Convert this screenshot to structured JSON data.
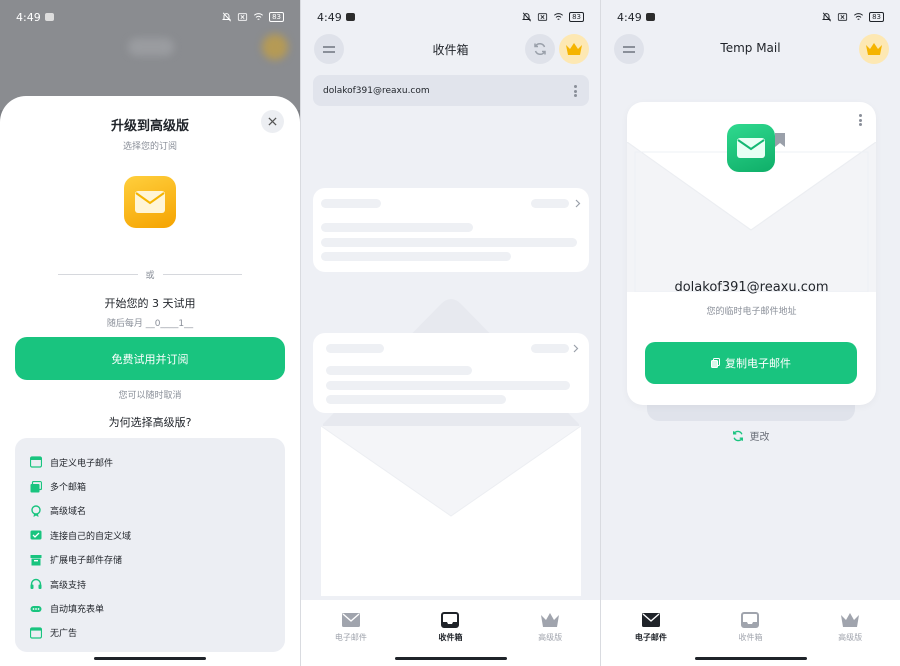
{
  "status": {
    "time": "4:49",
    "battery": "83"
  },
  "premium": {
    "title": "升级到高级版",
    "subtitle": "选择您的订阅",
    "or": "或",
    "trial_title": "开始您的 3 天试用",
    "trial_note": "随后每月 __0____1__",
    "cta": "免费试用并订阅",
    "cancel_note": "您可以随时取消",
    "why_title": "为何选择高级版?",
    "features": [
      {
        "label": "自定义电子邮件",
        "icon": "calendar-icon"
      },
      {
        "label": "多个邮箱",
        "icon": "images-icon"
      },
      {
        "label": "高级域名",
        "icon": "badge-icon"
      },
      {
        "label": "连接自己的自定义域",
        "icon": "check-mail-icon"
      },
      {
        "label": "扩展电子邮件存储",
        "icon": "archive-icon"
      },
      {
        "label": "高级支持",
        "icon": "headset-icon"
      },
      {
        "label": "自动填充表单",
        "icon": "dots-icon"
      },
      {
        "label": "无广告",
        "icon": "window-icon"
      }
    ],
    "accent": "#19c47f"
  },
  "inbox": {
    "title": "收件箱",
    "address": "dolakof391@reaxu.com"
  },
  "tempmail": {
    "title": "Temp Mail",
    "address": "dolakof391@reaxu.com",
    "address_caption": "您的临时电子邮件地址",
    "copy_label": "复制电子邮件",
    "change_label": "更改"
  },
  "nav": {
    "mail": "电子邮件",
    "inbox": "收件箱",
    "premium": "高级版"
  }
}
